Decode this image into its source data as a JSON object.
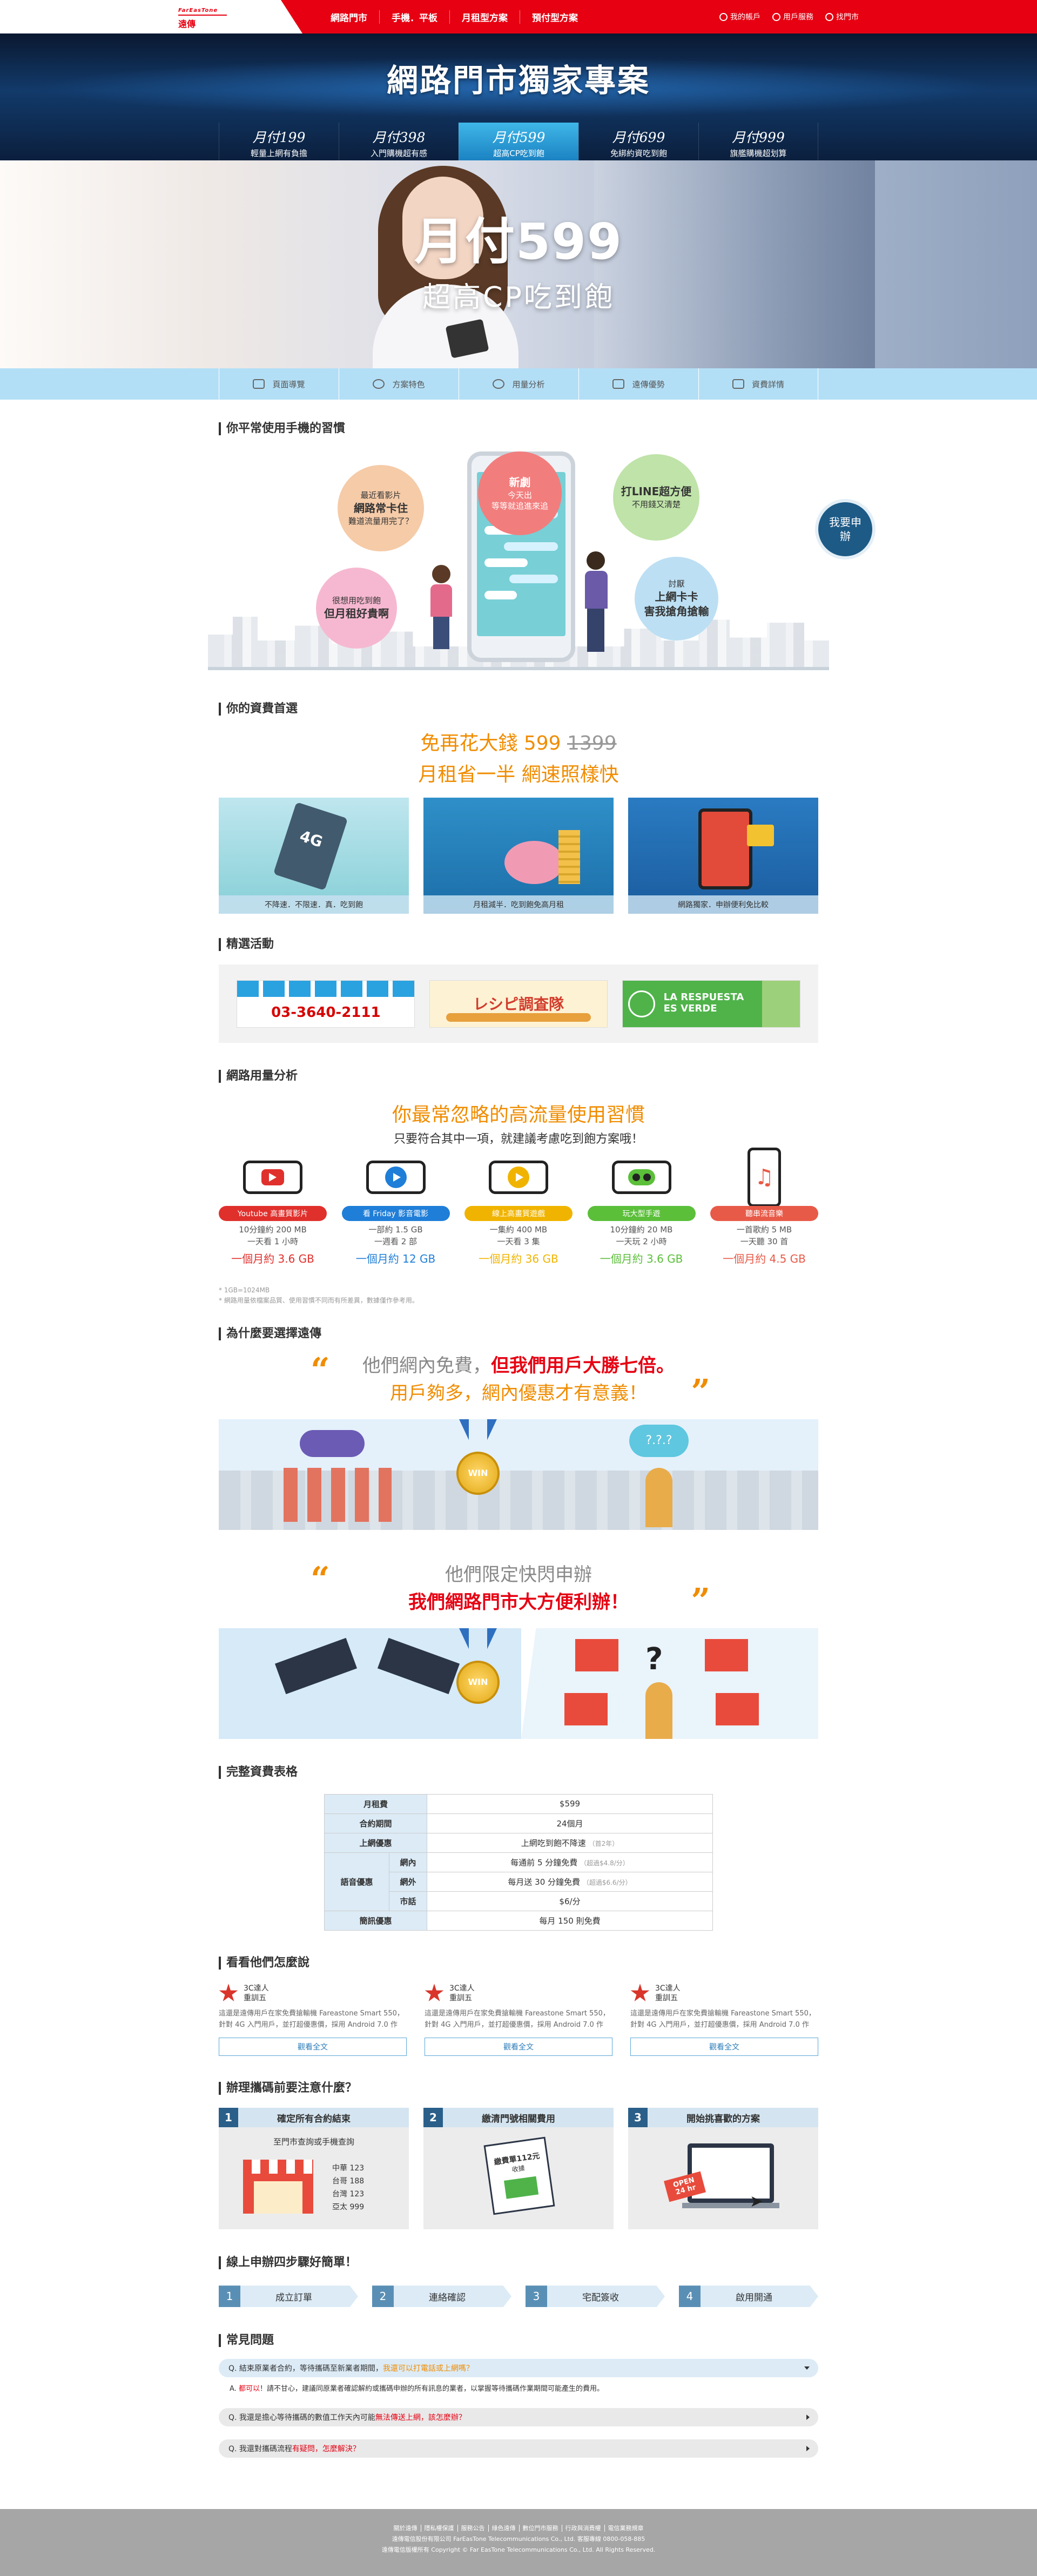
{
  "logo": {
    "line1": "FarEasTone",
    "line2": "遠傳"
  },
  "topnav": [
    "網路門市",
    "手機．平板",
    "月租型方案",
    "預付型方案"
  ],
  "toplinks": [
    "我的帳戶",
    "用戶服務",
    "找門市"
  ],
  "hero": {
    "title": "網路門市獨家專案"
  },
  "plans": [
    {
      "price": "月付199",
      "sub": "輕量上網有負擔"
    },
    {
      "price": "月付398",
      "sub": "入門購機超有感"
    },
    {
      "price": "月付599",
      "sub": "超高CP吃到飽"
    },
    {
      "price": "月付699",
      "sub": "免綁約資吃到飽"
    },
    {
      "price": "月付999",
      "sub": "旗艦購機超划算"
    }
  ],
  "banner": {
    "line1": "月付599",
    "line2": "超高CP吃到飽"
  },
  "subnav": [
    "頁面導覽",
    "方案特色",
    "用量分析",
    "遠傳優勢",
    "資費詳情"
  ],
  "habits": {
    "title": "你平常使用手機的習慣",
    "bubbles": [
      {
        "a": "最近看影片",
        "b": "網路常卡住",
        "c": "難道流量用完了？"
      },
      {
        "a": "新劇",
        "b": "今天出",
        "c": "等等就追進來追"
      },
      {
        "a": "打LINE超方便",
        "b": "",
        "c": "不用錢又清楚"
      },
      {
        "a": "很想用吃到飽",
        "b": "",
        "c": "但月租好貴啊"
      },
      {
        "a": "討厭",
        "b": "上網卡卡",
        "c": "害我搶角搶輸"
      }
    ],
    "apply": "我要申辦"
  },
  "rate": {
    "title": "你的資費首選",
    "line1_prefix": "免再花大錢",
    "price_new": "599",
    "price_old": "1399",
    "line2": "月租省一半 網速照樣快",
    "cards": [
      "不降速．不限速．真．吃到飽",
      "月租減半．吃到飽免高月租",
      "網路獨家．申辦便利免比較"
    ]
  },
  "activities": {
    "title": "精選活動",
    "items": [
      "03-3640-2111",
      "レシピ調査隊",
      "LA RESPUESTA ES VERDE"
    ]
  },
  "usage": {
    "title": "網路用量分析",
    "h1": "你最常忽略的高流量使用習慣",
    "h2": "只要符合其中一項，就建議考慮吃到飽方案哦！",
    "items": [
      {
        "tag": "Youtube 高畫質影片",
        "l1": "10分鐘約 200 MB",
        "l2": "一天看 1 小時",
        "total": "一個月約 3.6 GB",
        "color": "#e0302c"
      },
      {
        "tag": "看 Friday 影音電影",
        "l1": "一部約 1.5 GB",
        "l2": "一週看 2 部",
        "total": "一個月約 12 GB",
        "color": "#1f7ed8"
      },
      {
        "tag": "線上高畫質遊戲",
        "l1": "一集約 400 MB",
        "l2": "一天看 3 集",
        "total": "一個月約 36 GB",
        "color": "#f0b400"
      },
      {
        "tag": "玩大型手遊",
        "l1": "10分鐘約 20 MB",
        "l2": "一天玩 2 小時",
        "total": "一個月約 3.6 GB",
        "color": "#5bbf3a"
      },
      {
        "tag": "聽串流音樂",
        "l1": "一首歌約 5 MB",
        "l2": "一天聽 30 首",
        "total": "一個月約 4.5 GB",
        "color": "#e85a48"
      }
    ],
    "notes": [
      "* 1GB=1024MB",
      "* 網路用量依檔案品質、使用習慣不同而有所差異，數據僅作參考用。"
    ]
  },
  "why": {
    "title": "為什麼要選擇遠傳",
    "q1a": "他們網內免費，",
    "q1b": "但我們用戶大勝七倍。",
    "q1c": "用戶夠多，網內優惠才有意義！",
    "q2a": "他們限定快閃申辦",
    "q2b": "我們網路門市大方便利辦！",
    "medal": "WIN",
    "thought": "?.?.?"
  },
  "table": {
    "title": "完整資費表格",
    "rows": [
      {
        "label": "月租費",
        "value": "$599",
        "note": ""
      },
      {
        "label": "合約期間",
        "value": "24個月",
        "note": ""
      },
      {
        "label": "上網優惠",
        "value": "上網吃到飽不降速",
        "note": "（首2年）"
      }
    ],
    "voice_label": "語音優惠",
    "voice": [
      {
        "sub": "網內",
        "value": "每通前 5 分鐘免費",
        "note": "（超過$4.8/分）"
      },
      {
        "sub": "網外",
        "value": "每月送 30 分鐘免費",
        "note": "（超過$6.6/分）"
      },
      {
        "sub": "市話",
        "value": "$6/分",
        "note": ""
      }
    ],
    "sms": {
      "label": "簡訊優惠",
      "value": "每月 150 則免費"
    }
  },
  "reviews": {
    "title": "看看他們怎麼說",
    "items": [
      {
        "name1": "3C達人",
        "name2": "重訓五",
        "text": "這還是遠傳用戶在家免費搶輸機 Fareastone Smart 550，針對 4G 入門用戶，並打超優惠價，採用 Android 7.0 作業...",
        "btn": "觀看全文"
      },
      {
        "name1": "3C達人",
        "name2": "重訓五",
        "text": "這還是遠傳用戶在家免費搶輸機 Fareastone Smart 550，針對 4G 入門用戶，並打超優惠價，採用 Android 7.0 作業...",
        "btn": "觀看全文"
      },
      {
        "name1": "3C達人",
        "name2": "重訓五",
        "text": "這還是遠傳用戶在家免費搶輸機 Fareastone Smart 550，針對 4G 入門用戶，並打超優惠價，採用 Android 7.0 作業...",
        "btn": "觀看全文"
      }
    ]
  },
  "before": {
    "title": "辦理攜碼前要注意什麼？",
    "items": [
      {
        "n": "1",
        "title": "確定所有合約結束",
        "sub": "至門市查詢或手機查詢",
        "vals": [
          "中華 123",
          "台哥 188",
          "台灣 123",
          "亞太 999"
        ]
      },
      {
        "n": "2",
        "title": "繳清門號相關費用",
        "sub": "",
        "vals": [
          "繳費單112元",
          "收據"
        ]
      },
      {
        "n": "3",
        "title": "開始挑喜歡的方案",
        "sub": "",
        "vals": [
          "OPEN",
          "24 hr"
        ]
      }
    ]
  },
  "steps": {
    "title": "線上申辦四步驟好簡單！",
    "items": [
      {
        "n": "1",
        "t": "成立訂單"
      },
      {
        "n": "2",
        "t": "連絡確認"
      },
      {
        "n": "3",
        "t": "宅配簽收"
      },
      {
        "n": "4",
        "t": "啟用開通"
      }
    ]
  },
  "faq": {
    "title": "常見問題",
    "q1a": "Q. 結束原業者合約，等待攜碼至新業者期間，",
    "q1b": "我還可以打電話或上網嗎？",
    "a1a": "A. ",
    "a1b": "都可以",
    "a1c": "！請不甘心，建議同原業者確認解約或攜碼申辦的所有訊息的業者，以掌握等待攜碼作業期間可能產生的費用。",
    "q2a": "Q. 我還是擔心等待攜碼的數值工作天內可能",
    "q2b": "無法傳送上網，該怎麼辦？",
    "q3a": "Q. 我還對攜碼流程",
    "q3b": "有疑問，怎麼解決？"
  },
  "footer": {
    "links": [
      "關於遠傳",
      "隱私權保護",
      "服務公告",
      "綠色遠傳",
      "數位門市服務",
      "行政與消費權",
      "電信業務規章"
    ],
    "line2": "遠傳電信股份有限公司 FarEasTone Telecommunications Co., Ltd.  客服專線 0800-058-885",
    "line3": "遠傳電信版權所有 Copyright © Far EasTone Telecommunications Co., Ltd. All Rights Reserved."
  }
}
